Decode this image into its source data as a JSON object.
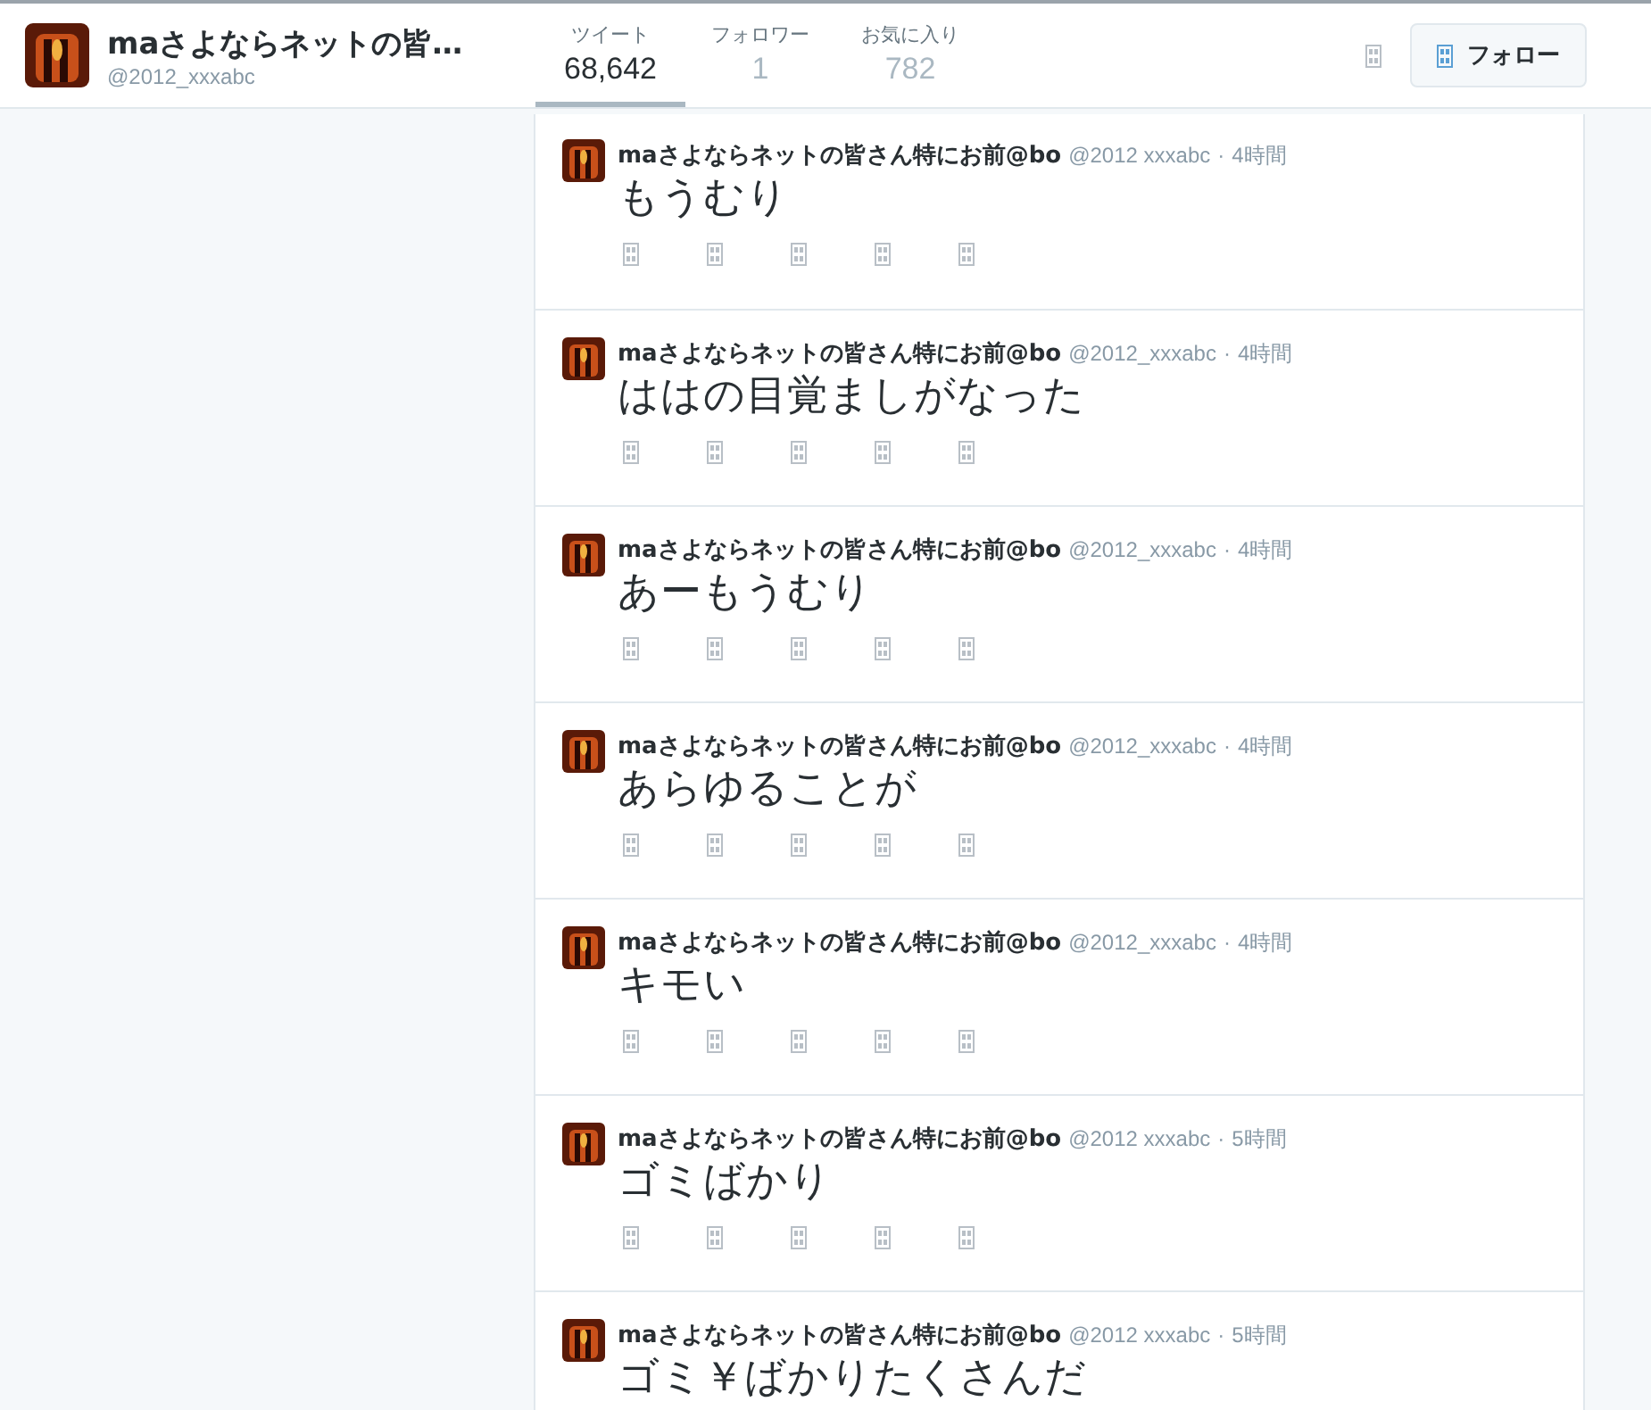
{
  "profile": {
    "name": "maさよならネットの皆…",
    "handle": "@2012_xxxabc"
  },
  "stats": [
    {
      "label": "ツイート",
      "value": "68,642",
      "selected": true
    },
    {
      "label": "フォロワー",
      "value": "1",
      "selected": false
    },
    {
      "label": "お気に入り",
      "value": "782",
      "selected": false
    }
  ],
  "follow_button": {
    "label": "フォロー"
  },
  "tweets": [
    {
      "name": "maさよならネットの皆さん特にお前@bo",
      "handle": "@2012 xxxabc",
      "separator": "·",
      "time": "4時間",
      "text": "もうむり"
    },
    {
      "name": "maさよならネットの皆さん特にお前@bo",
      "handle": "@2012_xxxabc",
      "separator": "·",
      "time": "4時間",
      "text": "ははの目覚ましがなった"
    },
    {
      "name": "maさよならネットの皆さん特にお前@bo",
      "handle": "@2012_xxxabc",
      "separator": "·",
      "time": "4時間",
      "text": "あーもうむり"
    },
    {
      "name": "maさよならネットの皆さん特にお前@bo",
      "handle": "@2012_xxxabc",
      "separator": "·",
      "time": "4時間",
      "text": "あらゆることが"
    },
    {
      "name": "maさよならネットの皆さん特にお前@bo",
      "handle": "@2012_xxxabc",
      "separator": "·",
      "time": "4時間",
      "text": "キモい"
    },
    {
      "name": "maさよならネットの皆さん特にお前@bo",
      "handle": "@2012 xxxabc",
      "separator": "·",
      "time": "5時間",
      "text": "ゴミばかり"
    },
    {
      "name": "maさよならネットの皆さん特にお前@bo",
      "handle": "@2012 xxxabc",
      "separator": "·",
      "time": "5時間",
      "text": "ゴミ￥ばかりたくさんだ"
    }
  ]
}
